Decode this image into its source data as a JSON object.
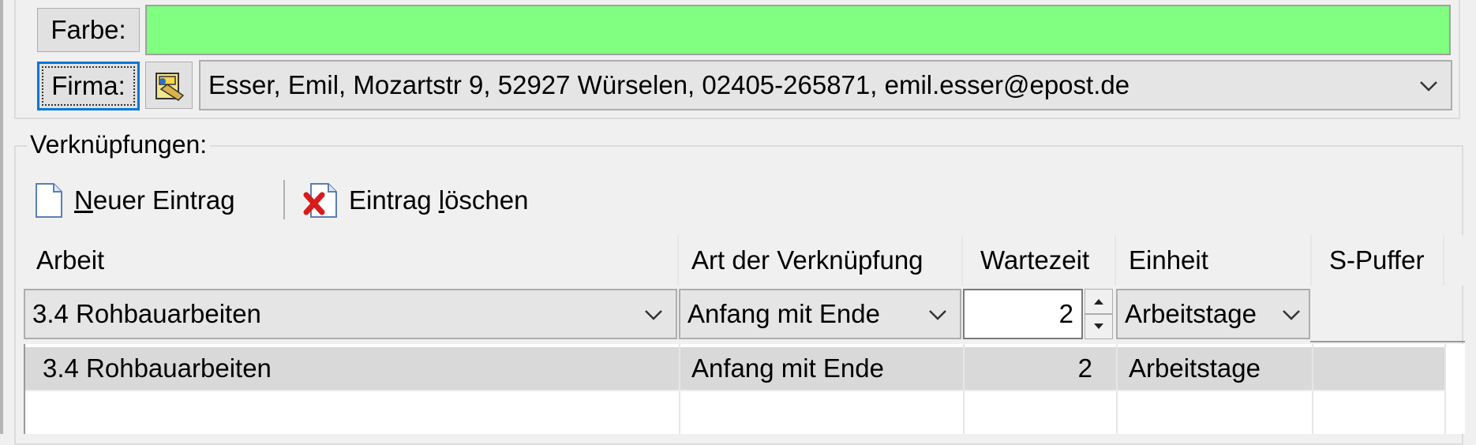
{
  "farbe": {
    "label": "Farbe:",
    "color": "#80ff80"
  },
  "firma": {
    "label": "Firma:",
    "picker_icon": "address-book-icon",
    "value": "Esser, Emil, Mozartstr 9, 52927 Würselen, 02405-265871, emil.esser@epost.de"
  },
  "verknuepfungen": {
    "legend": "Verknüpfungen:",
    "toolbar": {
      "new_icon": "new-document-icon",
      "new_mnemonic": "N",
      "new_rest": "euer Eintrag",
      "delete_icon": "delete-document-icon",
      "delete_before": "Eintrag ",
      "delete_mnemonic": "l",
      "delete_after": "öschen"
    },
    "columns": [
      "Arbeit",
      "Art der Verknüpfung",
      "Wartezeit",
      "Einheit",
      "S-Puffer"
    ],
    "editor": {
      "arbeit": "3.4 Rohbauarbeiten",
      "art": "Anfang mit Ende",
      "wartezeit": "2",
      "einheit": "Arbeitstage"
    },
    "rows": [
      {
        "arbeit": "3.4 Rohbauarbeiten",
        "art": "Anfang mit Ende",
        "wartezeit": "2",
        "einheit": "Arbeitstage",
        "spuffer": ""
      }
    ]
  }
}
